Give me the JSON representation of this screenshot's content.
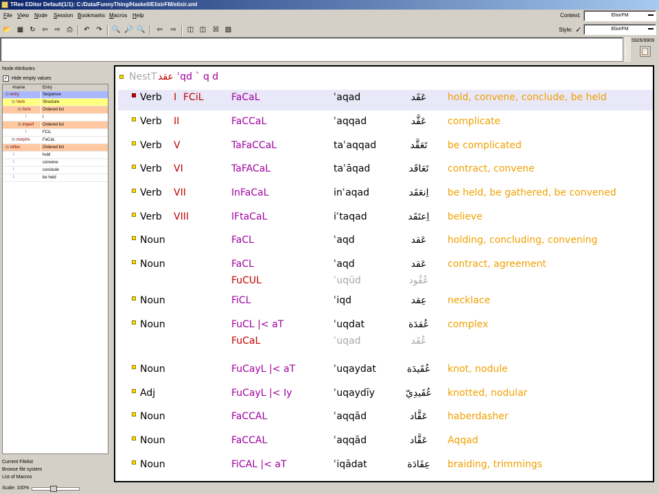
{
  "window": {
    "title": "TRee EDitor   Default(1/1): C:/Data/FunnyThing/Haskell/ElixirFM/elixir.xml"
  },
  "menu": [
    "File",
    "View",
    "Node",
    "Session",
    "Bookmarks",
    "Macros",
    "Help"
  ],
  "context": {
    "label": "Context:",
    "value": "ElixirFM"
  },
  "style": {
    "label": "Style:",
    "value": "ElixirFM"
  },
  "toolbar_icons": [
    "open-icon",
    "save-icon",
    "reload-icon",
    "prev-file-icon",
    "next-file-icon",
    "print-icon",
    "undo-icon",
    "redo-icon",
    "find-icon",
    "find-next-icon",
    "find-prev-icon",
    "back-icon",
    "forward-icon",
    "split-h-icon",
    "split-v-icon",
    "close-view-icon",
    "macro-icon"
  ],
  "counter": "5926/9909",
  "left_panel": {
    "title": "Node Attributes",
    "hide_empty": "Hide empty values",
    "hide_empty_checked": true,
    "columns": [
      "#name",
      "Entry"
    ],
    "rows": [
      {
        "name": "entry",
        "value": "Sequence",
        "indent": 0,
        "highlight": "blue"
      },
      {
        "name": "Verb",
        "value": "Structure",
        "indent": 1,
        "highlight": "yellow"
      },
      {
        "name": "form",
        "value": "Ordered list",
        "indent": 2,
        "highlight": "orange"
      },
      {
        "name": "",
        "value": "I",
        "indent": 3,
        "highlight": "none"
      },
      {
        "name": "imperf",
        "value": "Ordered list",
        "indent": 2,
        "highlight": "orange"
      },
      {
        "name": "",
        "value": "FCiL",
        "indent": 3,
        "highlight": "none"
      },
      {
        "name": "morphs",
        "value": "FaCaL",
        "indent": 1,
        "highlight": "none"
      },
      {
        "name": "reflex",
        "value": "Ordered list",
        "indent": 0,
        "highlight": "orange"
      },
      {
        "name": "",
        "value": "hold",
        "indent": 1,
        "highlight": "none"
      },
      {
        "name": "",
        "value": "convene",
        "indent": 1,
        "highlight": "none"
      },
      {
        "name": "",
        "value": "conclude",
        "indent": 1,
        "highlight": "none"
      },
      {
        "name": "",
        "value": "be held",
        "indent": 1,
        "highlight": "none"
      }
    ]
  },
  "bottom_left": [
    "Current Filelist",
    "Browse file system",
    "List of Macros"
  ],
  "status": {
    "zoom": "Scale: 100%",
    "zoom_level": 0.45
  },
  "tree": {
    "nest_label": "NestT",
    "nest_arabic": "عقد",
    "nest_root": "ʿqd ` q d",
    "entries": [
      {
        "cat": "Verb",
        "form": "I",
        "ffmt": "FCiL",
        "morphs": [
          "FaCaL"
        ],
        "trans": [
          "ʿaqad"
        ],
        "arabic": [
          "عَقَد"
        ],
        "gloss": "hold, convene, conclude, be held",
        "selected": true
      },
      {
        "cat": "Verb",
        "form": "II",
        "ffmt": "",
        "morphs": [
          "FaCCaL"
        ],
        "trans": [
          "ʿaqqad"
        ],
        "arabic": [
          "عَقَّد"
        ],
        "gloss": "complicate"
      },
      {
        "cat": "Verb",
        "form": "V",
        "ffmt": "",
        "morphs": [
          "TaFaCCaL"
        ],
        "trans": [
          "taʿaqqad"
        ],
        "arabic": [
          "تَعَقَّد"
        ],
        "gloss": "be complicated"
      },
      {
        "cat": "Verb",
        "form": "VI",
        "ffmt": "",
        "morphs": [
          "TaFACaL"
        ],
        "trans": [
          "taʿāqad"
        ],
        "arabic": [
          "تَعَاقَد"
        ],
        "gloss": "contract, convene"
      },
      {
        "cat": "Verb",
        "form": "VII",
        "ffmt": "",
        "morphs": [
          "InFaCaL"
        ],
        "trans": [
          "inʿaqad"
        ],
        "arabic": [
          "اِنعَقَد"
        ],
        "gloss": "be held, be gathered, be convened"
      },
      {
        "cat": "Verb",
        "form": "VIII",
        "ffmt": "",
        "morphs": [
          "IFtaCaL"
        ],
        "trans": [
          "iʿtaqad"
        ],
        "arabic": [
          "اِعتَقَد"
        ],
        "gloss": "believe"
      },
      {
        "cat": "Noun",
        "form": "",
        "ffmt": "",
        "morphs": [
          "FaCL"
        ],
        "trans": [
          "ʿaqd"
        ],
        "arabic": [
          "عَقد"
        ],
        "gloss": "holding, concluding, convening"
      },
      {
        "cat": "Noun",
        "form": "",
        "ffmt": "",
        "morphs": [
          "FaCL",
          "FuCUL"
        ],
        "trans": [
          "ʿaqd",
          "ʿuqūd"
        ],
        "arabic": [
          "عَقد",
          "عُقُود"
        ],
        "gloss": "contract, agreement"
      },
      {
        "cat": "Noun",
        "form": "",
        "ffmt": "",
        "morphs": [
          "FiCL"
        ],
        "trans": [
          "ʿiqd"
        ],
        "arabic": [
          "عِقد"
        ],
        "gloss": "necklace"
      },
      {
        "cat": "Noun",
        "form": "",
        "ffmt": "",
        "morphs": [
          "FuCL |< aT",
          "FuCaL"
        ],
        "trans": [
          "ʿuqdat",
          "ʿuqad"
        ],
        "arabic": [
          "عُقدَة",
          "عُقَد"
        ],
        "gloss": "complex"
      },
      {
        "cat": "Noun",
        "form": "",
        "ffmt": "",
        "morphs": [
          "FuCayL |< aT"
        ],
        "trans": [
          "ʿuqaydat"
        ],
        "arabic": [
          "عُقَيدَة"
        ],
        "gloss": "knot, nodule"
      },
      {
        "cat": "Adj",
        "form": "",
        "ffmt": "",
        "morphs": [
          "FuCayL |< Iy"
        ],
        "trans": [
          "ʿuqaydīy"
        ],
        "arabic": [
          "عُقَيدِيّ"
        ],
        "gloss": "knotted, nodular"
      },
      {
        "cat": "Noun",
        "form": "",
        "ffmt": "",
        "morphs": [
          "FaCCAL"
        ],
        "trans": [
          "ʿaqqād"
        ],
        "arabic": [
          "عَقَّاد"
        ],
        "gloss": "haberdasher"
      },
      {
        "cat": "Noun",
        "form": "",
        "ffmt": "",
        "morphs": [
          "FaCCAL"
        ],
        "trans": [
          "ʿaqqād"
        ],
        "arabic": [
          "عَقَّاد"
        ],
        "gloss": "Aqqad"
      },
      {
        "cat": "Noun",
        "form": "",
        "ffmt": "",
        "morphs": [
          "FiCAL |< aT"
        ],
        "trans": [
          "ʿiqādat"
        ],
        "arabic": [
          "عِقَادَة"
        ],
        "gloss": "braiding, trimmings"
      }
    ]
  }
}
